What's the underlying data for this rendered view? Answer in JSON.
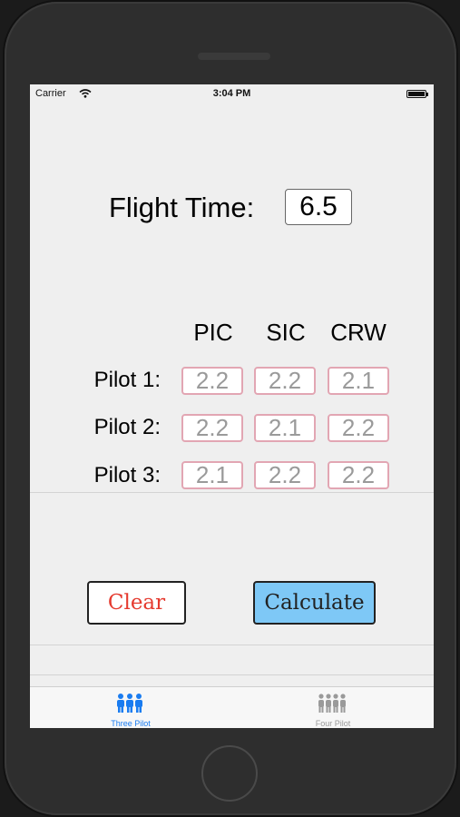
{
  "status_bar": {
    "carrier": "Carrier",
    "time": "3:04 PM"
  },
  "flight_time": {
    "label": "Flight Time:",
    "value": "6.5"
  },
  "columns": [
    "PIC",
    "SIC",
    "CRW"
  ],
  "pilots": [
    {
      "label": "Pilot 1:",
      "values": [
        "2.2",
        "2.2",
        "2.1"
      ]
    },
    {
      "label": "Pilot 2:",
      "values": [
        "2.2",
        "2.1",
        "2.2"
      ]
    },
    {
      "label": "Pilot 3:",
      "values": [
        "2.1",
        "2.2",
        "2.2"
      ]
    }
  ],
  "buttons": {
    "clear": "Clear",
    "calculate": "Calculate"
  },
  "tabs": [
    {
      "label": "Three Pilot",
      "icon": "three-pilots-icon",
      "active": true
    },
    {
      "label": "Four Pilot",
      "icon": "four-pilots-icon",
      "active": false
    }
  ],
  "colors": {
    "accent": "#1a7cf0",
    "clear_text": "#e53a2f",
    "calculate_bg": "#7ec8f6",
    "cell_border": "#e2a6b3"
  }
}
